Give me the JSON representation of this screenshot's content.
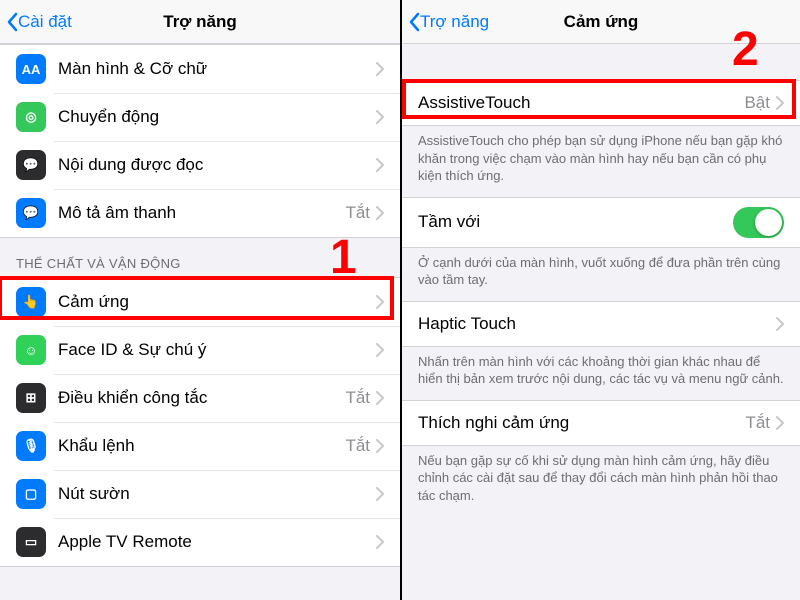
{
  "left": {
    "back": "Cài đặt",
    "title": "Trợ năng",
    "rows1": [
      {
        "label": "Màn hình & Cỡ chữ",
        "icon_bg": "#007aff",
        "icon_glyph": "AA",
        "icon_name": "display-text-icon"
      },
      {
        "label": "Chuyển động",
        "icon_bg": "#34c759",
        "icon_glyph": "◎",
        "icon_name": "motion-icon"
      },
      {
        "label": "Nội dung được đọc",
        "icon_bg": "#2c2c2e",
        "icon_glyph": "💬",
        "icon_name": "spoken-content-icon"
      },
      {
        "label": "Mô tả âm thanh",
        "icon_bg": "#007aff",
        "icon_glyph": "💬",
        "icon_name": "audio-desc-icon",
        "value": "Tắt"
      }
    ],
    "section2": "THỂ CHẤT VÀ VẬN ĐỘNG",
    "rows2": [
      {
        "label": "Cảm ứng",
        "icon_bg": "#007aff",
        "icon_glyph": "👆",
        "icon_name": "touch-icon"
      },
      {
        "label": "Face ID & Sự chú ý",
        "icon_bg": "#30d158",
        "icon_glyph": "☺",
        "icon_name": "faceid-icon"
      },
      {
        "label": "Điều khiển công tắc",
        "icon_bg": "#2c2c2e",
        "icon_glyph": "⊞",
        "icon_name": "switch-control-icon",
        "value": "Tắt"
      },
      {
        "label": "Khẩu lệnh",
        "icon_bg": "#007aff",
        "icon_glyph": "🎙",
        "icon_name": "voice-control-icon",
        "value": "Tắt"
      },
      {
        "label": "Nút sườn",
        "icon_bg": "#007aff",
        "icon_glyph": "▢",
        "icon_name": "side-button-icon"
      },
      {
        "label": "Apple TV Remote",
        "icon_bg": "#2c2c2e",
        "icon_glyph": "▭",
        "icon_name": "appletv-remote-icon"
      }
    ],
    "step": "1"
  },
  "right": {
    "back": "Trợ năng",
    "title": "Cảm ứng",
    "row_at": {
      "label": "AssistiveTouch",
      "value": "Bật"
    },
    "footer_at": "AssistiveTouch cho phép bạn sử dụng iPhone nếu bạn gặp khó khăn trong việc chạm vào màn hình hay nếu bạn cần có phụ kiện thích ứng.",
    "row_reach": "Tầm với",
    "footer_reach": "Ở cạnh dưới của màn hình, vuốt xuống để đưa phần trên cùng vào tầm tay.",
    "row_haptic": "Haptic Touch",
    "footer_haptic": "Nhấn trên màn hình với các khoảng thời gian khác nhau để hiển thị bản xem trước nội dung, các tác vụ và menu ngữ cảnh.",
    "row_accom": {
      "label": "Thích nghi cảm ứng",
      "value": "Tắt"
    },
    "footer_accom": "Nếu bạn gặp sự cố khi sử dụng màn hình cảm ứng, hãy điều chỉnh các cài đặt sau để thay đổi cách màn hình phản hồi thao tác chạm.",
    "step": "2"
  }
}
